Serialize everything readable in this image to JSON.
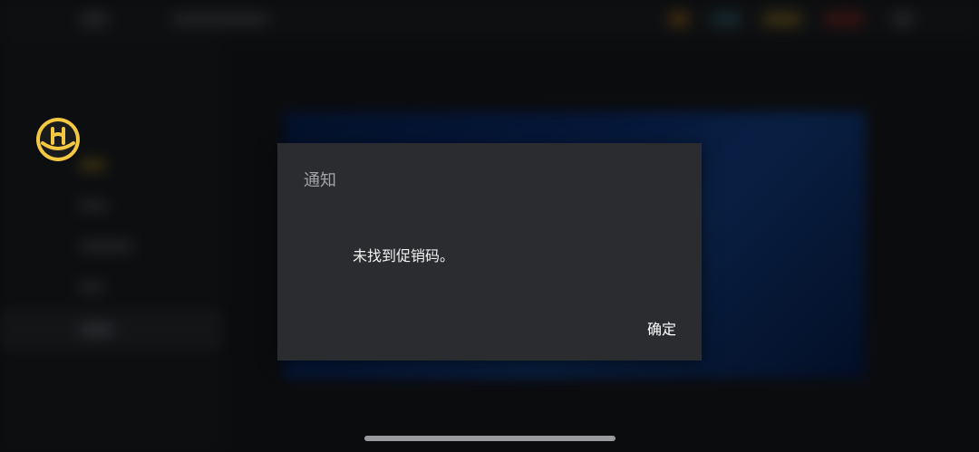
{
  "dialog": {
    "title": "通知",
    "message": "未找到促销码。",
    "confirm_label": "确定"
  },
  "colors": {
    "dialog_background": "#2b2c30",
    "logo_gold": "#f5c842"
  },
  "icons": {
    "app_logo": "wanda-logo-icon"
  }
}
